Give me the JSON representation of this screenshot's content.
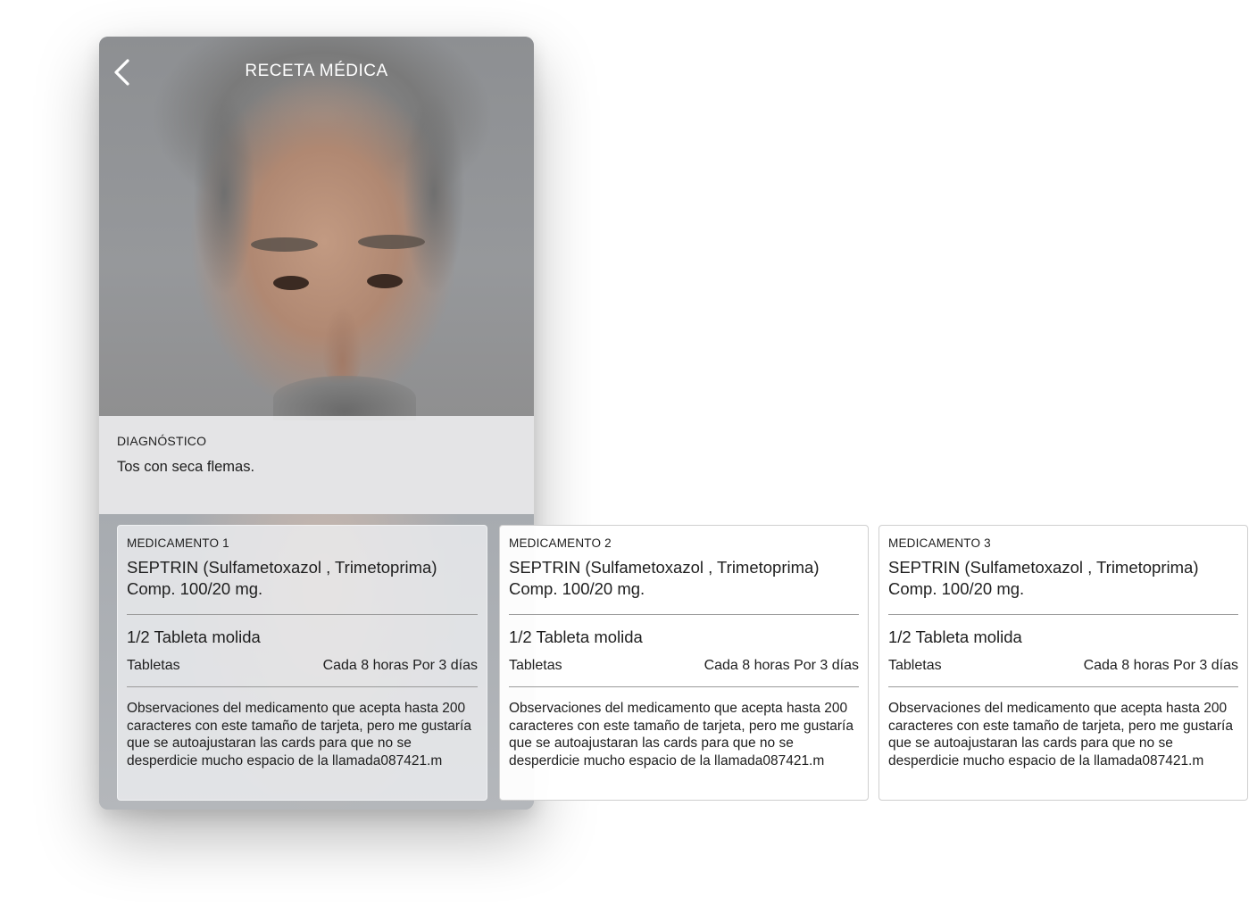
{
  "header": {
    "title": "RECETA MÉDICA",
    "back_icon": "chevron-left-icon"
  },
  "photo": {
    "description_icon": "patient-photo"
  },
  "diagnosis": {
    "label": "DIAGNÓSTICO",
    "text": "Tos con seca flemas."
  },
  "medications": [
    {
      "label": "MEDICAMENTO 1",
      "name": "SEPTRIN (Sulfametoxazol , Trimetoprima) Comp. 100/20 mg.",
      "dose": "1/2 Tableta molida",
      "form": "Tabletas",
      "frequency": "Cada 8 horas Por 3 días",
      "observations": "Observaciones del medicamento que acepta hasta 200 caracteres con este tamaño de tarjeta, pero me gustaría que se autoajustaran las cards para que no se desperdicie mucho espacio de la llamada087421.m"
    },
    {
      "label": "MEDICAMENTO 2",
      "name": "SEPTRIN (Sulfametoxazol , Trimetoprima) Comp. 100/20 mg.",
      "dose": "1/2 Tableta molida",
      "form": "Tabletas",
      "frequency": "Cada 8 horas Por 3 días",
      "observations": "Observaciones del medicamento que acepta hasta 200 caracteres con este tamaño de tarjeta, pero me gustaría que se autoajustaran las cards para que no se desperdicie mucho espacio de la llamada087421.m"
    },
    {
      "label": "MEDICAMENTO 3",
      "name": "SEPTRIN (Sulfametoxazol , Trimetoprima) Comp. 100/20 mg.",
      "dose": "1/2 Tableta molida",
      "form": "Tabletas",
      "frequency": "Cada 8 horas Por 3 días",
      "observations": "Observaciones del medicamento que acepta hasta 200 caracteres con este tamaño de tarjeta, pero me gustaría que se autoajustaran las cards para que no se desperdicie mucho espacio de la llamada087421.m"
    }
  ]
}
